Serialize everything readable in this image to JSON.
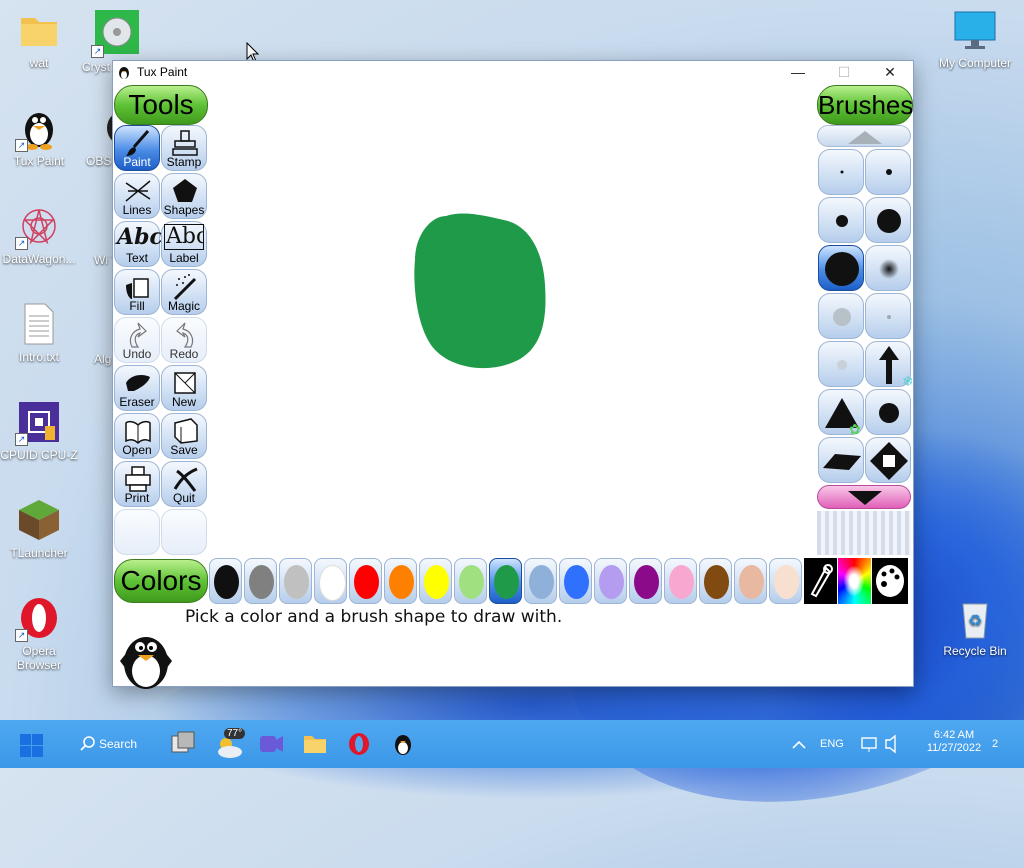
{
  "desktop": {
    "icons_left": [
      {
        "label": "wat",
        "icon": "folder-icon"
      },
      {
        "label": "Tux Paint",
        "icon": "tux-icon"
      },
      {
        "label": "DataWagon...",
        "icon": "datawagon-icon"
      },
      {
        "label": "Intro.txt",
        "icon": "text-file-icon"
      },
      {
        "label": "CPUID CPU-Z",
        "icon": "cpuz-icon"
      },
      {
        "label": "TLauncher",
        "icon": "minecraft-block-icon"
      },
      {
        "label": "Opera Browser",
        "icon": "opera-icon"
      }
    ],
    "icons_col2": [
      {
        "label": "Cryst",
        "icon": "crystaldisk-icon"
      },
      {
        "label": "OBS",
        "icon": "obs-icon"
      },
      {
        "label": "Wi\nTw",
        "icon": "app-icon"
      },
      {
        "label": "Alg",
        "icon": "app-icon"
      }
    ],
    "icons_right": [
      {
        "label": "My Computer",
        "icon": "monitor-icon"
      },
      {
        "label": "Recycle Bin",
        "icon": "recycle-bin-icon"
      }
    ]
  },
  "window": {
    "title": "Tux Paint",
    "controls": {
      "minimize": "—",
      "maximize": "☐",
      "close": "✕"
    }
  },
  "tools": {
    "header": "Tools",
    "items": [
      {
        "label": "Paint",
        "icon": "paintbrush-icon",
        "selected": true
      },
      {
        "label": "Stamp",
        "icon": "stamp-icon"
      },
      {
        "label": "Lines",
        "icon": "lines-icon"
      },
      {
        "label": "Shapes",
        "icon": "pentagon-icon"
      },
      {
        "label": "Text",
        "icon": "text-abc-icon"
      },
      {
        "label": "Label",
        "icon": "label-abc-icon"
      },
      {
        "label": "Fill",
        "icon": "paint-bucket-icon"
      },
      {
        "label": "Magic",
        "icon": "magic-wand-icon"
      },
      {
        "label": "Undo",
        "icon": "undo-hand-icon"
      },
      {
        "label": "Redo",
        "icon": "redo-hand-icon"
      },
      {
        "label": "Eraser",
        "icon": "eraser-icon"
      },
      {
        "label": "New",
        "icon": "new-page-icon"
      },
      {
        "label": "Open",
        "icon": "open-book-icon"
      },
      {
        "label": "Save",
        "icon": "save-book-icon"
      },
      {
        "label": "Print",
        "icon": "printer-icon"
      },
      {
        "label": "Quit",
        "icon": "quit-x-icon"
      }
    ],
    "text_glyph": "Abc"
  },
  "brushes": {
    "header": "Brushes",
    "scroll_up_icon": "arrow-up-icon",
    "scroll_down_icon": "arrow-down-icon"
  },
  "colors": {
    "header": "Colors",
    "palette": [
      {
        "hex": "#101010"
      },
      {
        "hex": "#808080"
      },
      {
        "hex": "#c0c0c0"
      },
      {
        "hex": "#ffffff"
      },
      {
        "hex": "#ff0000"
      },
      {
        "hex": "#ff8000"
      },
      {
        "hex": "#ffff00"
      },
      {
        "hex": "#a0e080"
      },
      {
        "hex": "#1f9a48",
        "selected": true
      },
      {
        "hex": "#8fb0d8"
      },
      {
        "hex": "#3070ff"
      },
      {
        "hex": "#b49cf0"
      },
      {
        "hex": "#8a0a8a"
      },
      {
        "hex": "#f8a8d0"
      },
      {
        "hex": "#804a10"
      },
      {
        "hex": "#e8b8a0"
      },
      {
        "hex": "#f8e0d0"
      }
    ],
    "extra_buttons": [
      "color-picker-icon",
      "rainbow-palette-icon",
      "paint-palette-icon"
    ]
  },
  "canvas": {
    "blob_color": "#1f9a48"
  },
  "status": {
    "message": "Pick a color and a brush shape to draw with."
  },
  "taskbar": {
    "search_label": "Search",
    "weather_temp": "77°",
    "language": "ENG",
    "time": "6:42 AM",
    "date": "11/27/2022",
    "notification_count": "2"
  }
}
